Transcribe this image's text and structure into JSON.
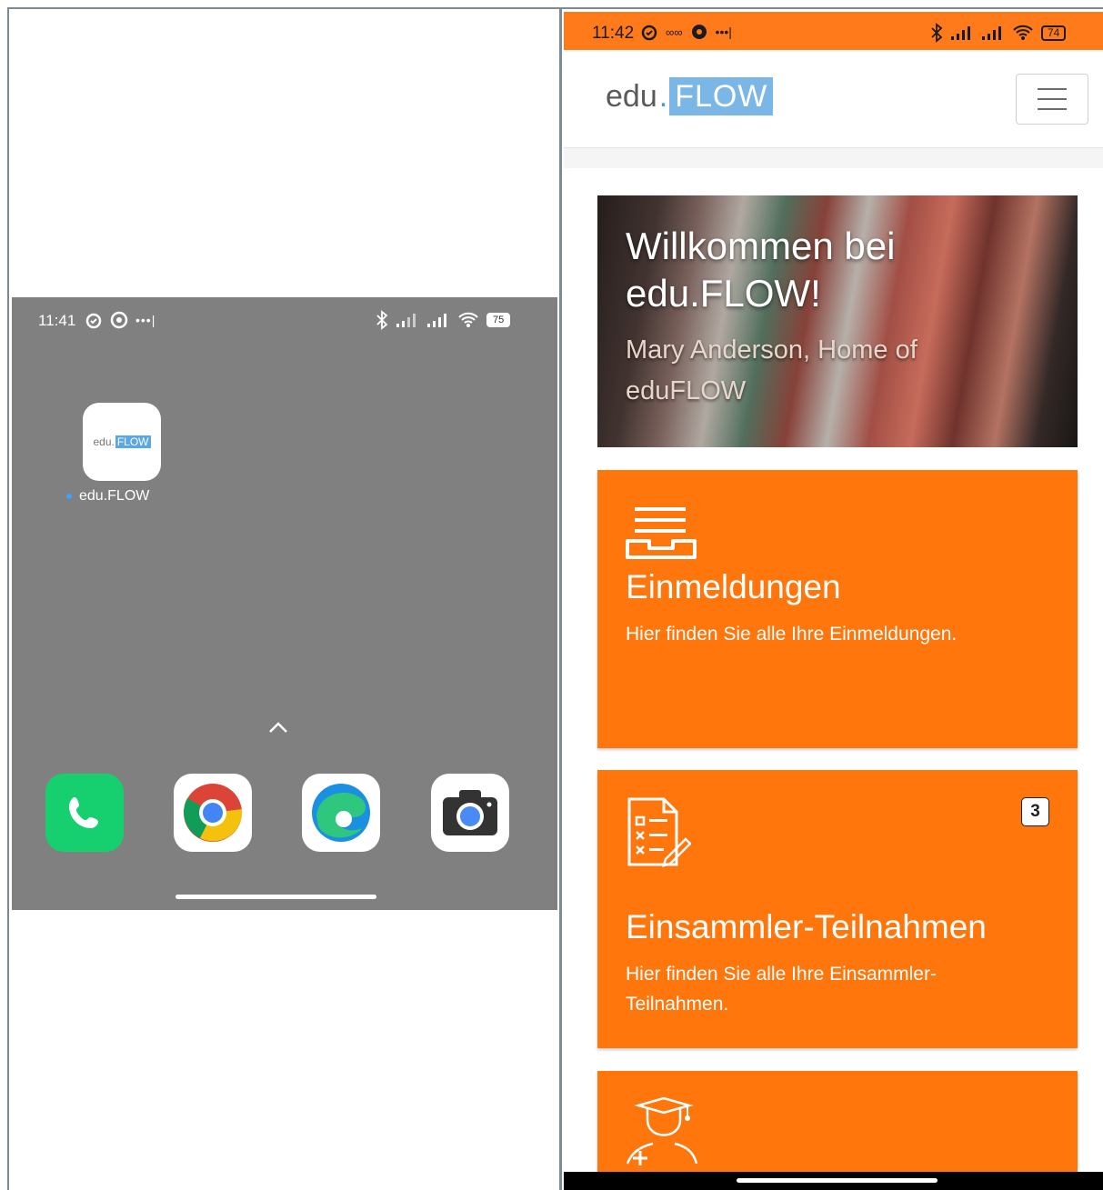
{
  "left_screen": {
    "status": {
      "time": "11:41",
      "battery": "75"
    },
    "app_icon": {
      "label": "edu.FLOW",
      "logo_text": "edu.",
      "logo_badge": "FLOW"
    },
    "dock": [
      {
        "name": "Phone",
        "icon": "phone-icon"
      },
      {
        "name": "Chrome",
        "icon": "chrome-icon"
      },
      {
        "name": "Edge",
        "icon": "edge-icon"
      },
      {
        "name": "Camera",
        "icon": "camera-icon"
      }
    ]
  },
  "right_screen": {
    "status": {
      "time": "11:42",
      "battery": "74"
    },
    "navbar": {
      "logo_text": "edu",
      "logo_dot": ".",
      "logo_badge": "FLOW",
      "menu_icon": "hamburger-menu-icon"
    },
    "hero": {
      "title": "Willkommen bei edu.FLOW!",
      "subtitle": "Mary Anderson, Home of eduFLOW"
    },
    "cards": [
      {
        "icon": "inbox-tray-icon",
        "title": "Einmeldungen",
        "text": "Hier finden Sie alle Ihre Einmeldungen."
      },
      {
        "icon": "checklist-document-icon",
        "title": "Einsammler-Teilnahmen",
        "text": "Hier finden Sie alle Ihre Einsammler-Teilnahmen.",
        "badge": "3"
      },
      {
        "icon": "graduate-student-icon"
      }
    ],
    "colors": {
      "accent": "#ff760d",
      "status_bar": "#ff7a1a",
      "logo_blue": "#7ab6e6"
    }
  }
}
